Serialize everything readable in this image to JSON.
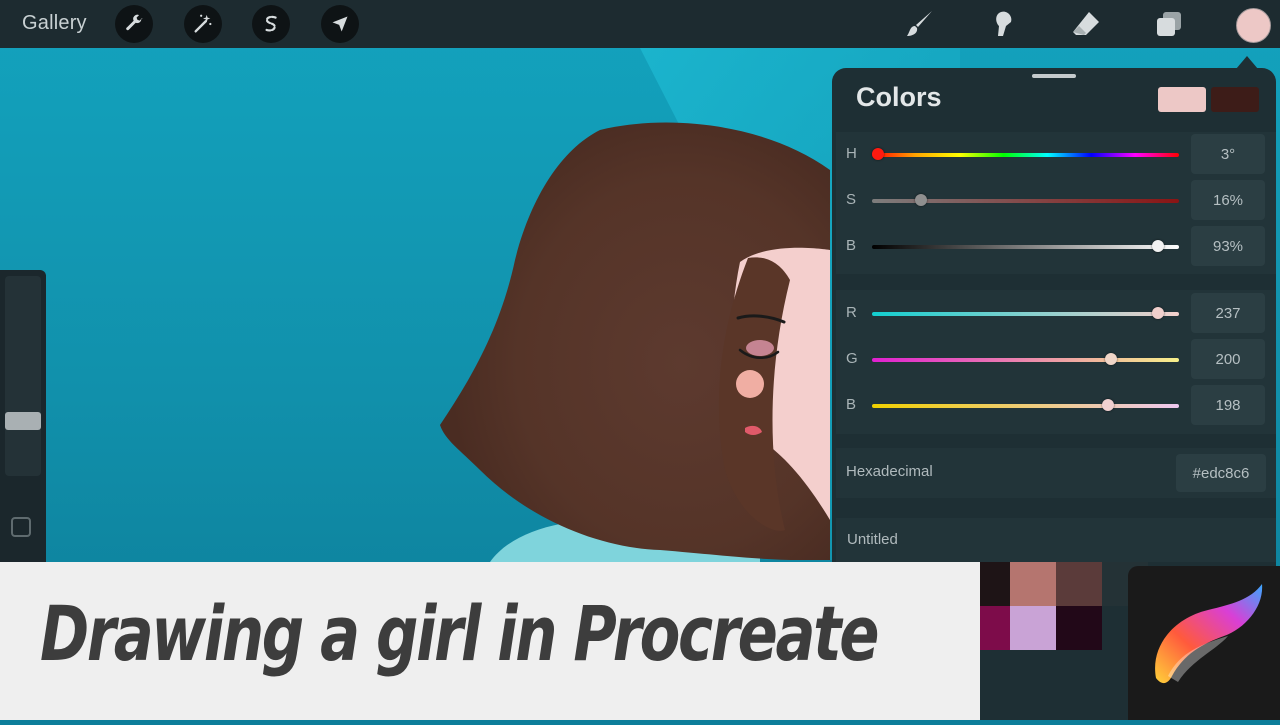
{
  "toolbar": {
    "gallery_label": "Gallery",
    "left_tools": [
      {
        "name": "actions",
        "icon": "wrench-icon"
      },
      {
        "name": "adjustments",
        "icon": "magic-wand-icon"
      },
      {
        "name": "selection",
        "icon": "selection-s-icon"
      },
      {
        "name": "transform",
        "icon": "arrow-cursor-icon"
      }
    ],
    "right_tools": [
      {
        "name": "brush",
        "icon": "brush-icon"
      },
      {
        "name": "smudge",
        "icon": "smudge-icon"
      },
      {
        "name": "eraser",
        "icon": "eraser-icon"
      },
      {
        "name": "layers",
        "icon": "layers-icon"
      }
    ],
    "active_color": "#edc8c6"
  },
  "colors_panel": {
    "title": "Colors",
    "primary_color": "#edc8c6",
    "secondary_color": "#3d1c18",
    "hsb": [
      {
        "label": "H",
        "value": "3°",
        "fraction": 0.02
      },
      {
        "label": "S",
        "value": "16%",
        "fraction": 0.16
      },
      {
        "label": "B",
        "value": "93%",
        "fraction": 0.93
      }
    ],
    "rgb": [
      {
        "label": "R",
        "value": "237",
        "fraction": 0.93
      },
      {
        "label": "G",
        "value": "200",
        "fraction": 0.78
      },
      {
        "label": "B",
        "value": "198",
        "fraction": 0.77
      }
    ],
    "hex_label": "Hexadecimal",
    "hex_value": "#edc8c6",
    "palette_name": "Untitled",
    "palette_swatches": [
      "#1e1416",
      "#b5756f",
      "#5b3b3a",
      "#243236",
      "#7d0c4a",
      "#c9a3d6",
      "#220818",
      "#1e2f34"
    ]
  },
  "banner": {
    "title": "Drawing a girl in Procreate"
  },
  "logo": {
    "icon": "procreate-logo-icon"
  }
}
